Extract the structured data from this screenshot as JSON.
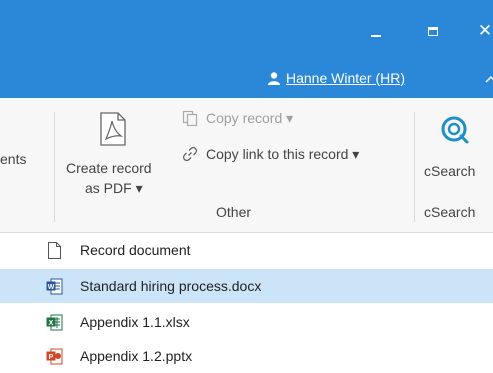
{
  "window": {
    "close_glyph": "✕"
  },
  "user": {
    "name": "Hanne Winter (HR)"
  },
  "ribbon": {
    "partial_label": "ents",
    "create_pdf": {
      "line1": "Create record",
      "line2": "as PDF ▾"
    },
    "copy_record": "Copy record ▾",
    "copy_link": "Copy link to this record ▾",
    "other_group": "Other",
    "csearch_button": "cSearch",
    "csearch_group": "cSearch"
  },
  "files": [
    {
      "name": "Record document",
      "icon": "document-icon",
      "selected": false
    },
    {
      "name": "Standard hiring process.docx",
      "icon": "word-icon",
      "selected": true
    },
    {
      "name": "Appendix 1.1.xlsx",
      "icon": "excel-icon",
      "selected": false
    },
    {
      "name": "Appendix 1.2.pptx",
      "icon": "powerpoint-icon",
      "selected": false
    }
  ],
  "colors": {
    "titlebar": "#2b88d8",
    "selection": "#cce4f7",
    "word": "#2b579a",
    "excel": "#217346",
    "powerpoint": "#d24726",
    "csearch": "#1e90c8"
  }
}
